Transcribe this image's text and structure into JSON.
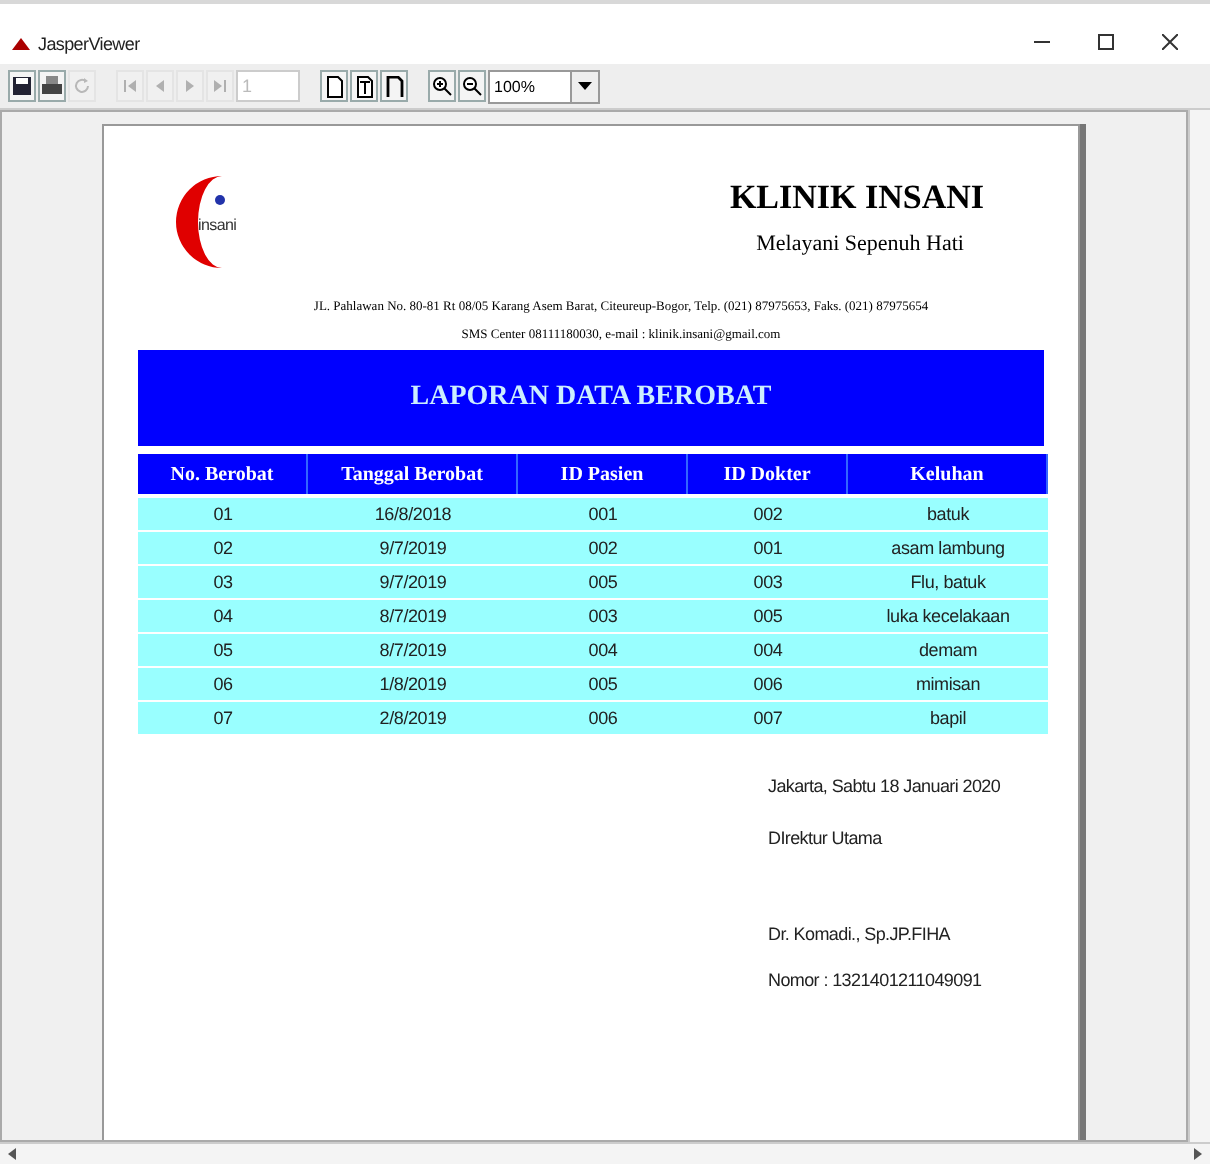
{
  "window": {
    "title": "JasperViewer"
  },
  "toolbar": {
    "buttons": [
      {
        "disabled": false
      },
      {
        "disabled": false
      },
      {
        "disabled": true
      },
      {
        "disabled": true
      },
      {
        "disabled": true
      },
      {
        "disabled": true
      },
      {
        "disabled": true
      }
    ],
    "page_field": {
      "value": "1",
      "disabled": true
    },
    "view_buttons": [
      {
        "selected": false
      },
      {
        "selected": false
      },
      {
        "selected": false
      }
    ],
    "zoom_buttons": [
      {
        "disabled": false
      },
      {
        "disabled": false
      }
    ],
    "zoom_combo": {
      "value": "100%"
    }
  },
  "report": {
    "logo_text": "insani",
    "clinic_name": "KLINIK INSANI",
    "tagline": "Melayani Sepenuh Hati",
    "address": "JL. Pahlawan No. 80-81 Rt 08/05 Karang Asem Barat, Citeureup-Bogor, Telp. (021) 87975653, Faks. (021) 87975654",
    "contact": "SMS Center 08111180030, e-mail : klinik.insani@gmail.com",
    "title": "LAPORAN DATA BEROBAT",
    "table": {
      "columns": [
        "No. Berobat",
        "Tanggal Berobat",
        "ID Pasien",
        "ID Dokter",
        "Keluhan"
      ],
      "rows": [
        [
          "01",
          "16/8/2018",
          "001",
          "002",
          "batuk"
        ],
        [
          "02",
          "9/7/2019",
          "002",
          "001",
          "asam lambung"
        ],
        [
          "03",
          "9/7/2019",
          "005",
          "003",
          "Flu, batuk"
        ],
        [
          "04",
          "8/7/2019",
          "003",
          "005",
          "luka kecelakaan"
        ],
        [
          "05",
          "8/7/2019",
          "004",
          "004",
          "demam"
        ],
        [
          "06",
          "1/8/2019",
          "005",
          "006",
          "mimisan"
        ],
        [
          "07",
          "2/8/2019",
          "006",
          "007",
          "bapil"
        ]
      ]
    },
    "place_date": "Jakarta, Sabtu 18 Januari 2020",
    "position": "DIrektur Utama",
    "signatory": "Dr. Komadi., Sp.JP.FIHA",
    "number": "Nomor : 1321401211049091"
  }
}
